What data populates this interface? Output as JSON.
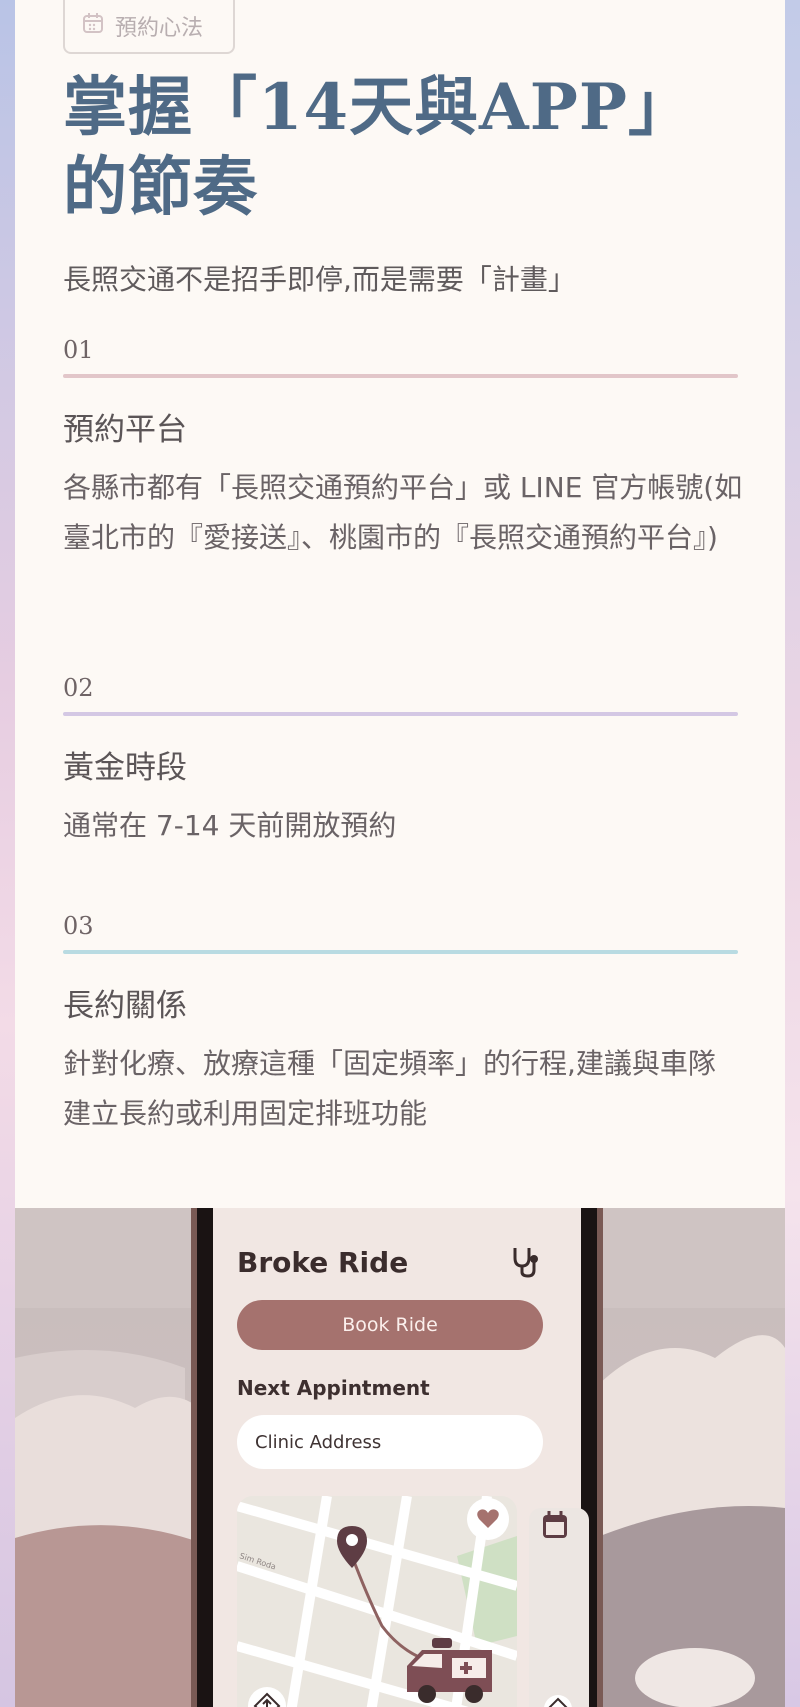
{
  "tag": {
    "icon": "calendar-icon",
    "label": "預約心法"
  },
  "title": "掌握「14天與APP」的節奏",
  "subtitle": "長照交通不是招手即停,而是需要「計畫」",
  "sections": [
    {
      "number": "01",
      "line_color": "#e2c6c9",
      "title": "預約平台",
      "body": "各縣市都有「長照交通預約平台」或 LINE 官方帳號(如臺北市的『愛接送』、桃園市的『長照交通預約平台』)"
    },
    {
      "number": "02",
      "line_color": "#d4c8e4",
      "title": "黃金時段",
      "body": "通常在 7-14 天前開放預約"
    },
    {
      "number": "03",
      "line_color": "#b9dbe2",
      "title": "長約關係",
      "body": "針對化療、放療這種「固定頻率」的行程,建議與車隊建立長約或利用固定排班功能"
    }
  ],
  "app": {
    "title": "Broke Ride",
    "book_button": "Book Ride",
    "next_label": "Next Appintment",
    "address_placeholder": "Clinic Address",
    "map_street_label": "Sim Roda",
    "icons": [
      "stethoscope-icon",
      "heart-icon",
      "location-pin-icon",
      "ambulance-icon",
      "calendar-icon",
      "direction-icon"
    ]
  },
  "colors": {
    "title": "#4f6a86",
    "button": "#a5726e",
    "pin": "#5e3d44"
  }
}
